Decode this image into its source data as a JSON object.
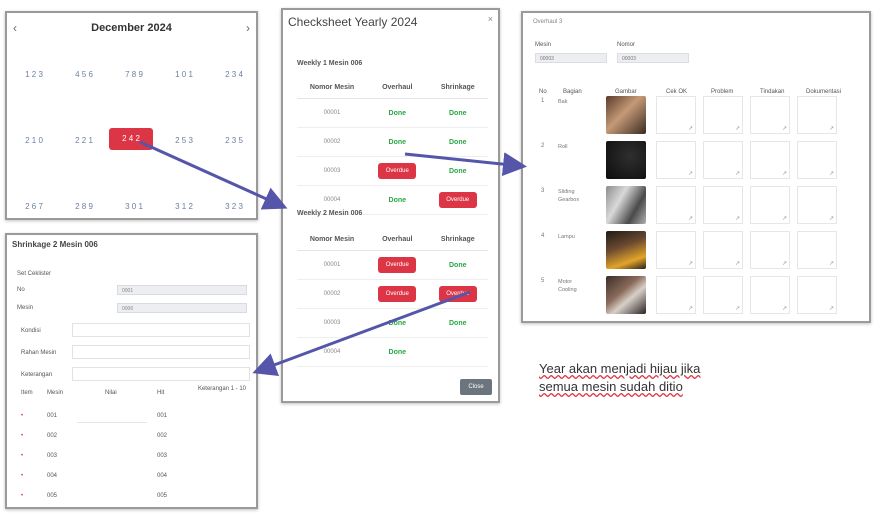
{
  "calendar": {
    "title": "December 2024",
    "prev": "‹",
    "next": "›",
    "days_row1": [
      "1 2 3",
      "4 5 6",
      "7 8 9",
      "1 0 1",
      "2 3 4"
    ],
    "days_row2": [
      "2 1 0",
      "2 2 1",
      "2 5 3",
      "2 3 5"
    ],
    "active_day": "2 4 2",
    "days_row3": [
      "2 6 7",
      "2 8 9",
      "3 0 1",
      "3 1 2",
      "3 2 3"
    ]
  },
  "checksheet": {
    "title": "Checksheet Yearly 2024",
    "close": "×",
    "section1": "Weekly 1 Mesin 006",
    "section2": "Weekly 2 Mesin 006",
    "headers": [
      "Nomor Mesin",
      "Overhaul",
      "Shrinkage"
    ],
    "rows1": [
      {
        "no": "00001",
        "overhaul": "Done",
        "shrinkage": "Done"
      },
      {
        "no": "00002",
        "overhaul": "Done",
        "shrinkage": "Done"
      },
      {
        "no": "00003",
        "overhaul": "Overdue",
        "shrinkage": "Done"
      },
      {
        "no": "00004",
        "overhaul": "Done",
        "shrinkage": "Overdue"
      }
    ],
    "rows2": [
      {
        "no": "00001",
        "overhaul": "Overdue",
        "shrinkage": "Done"
      },
      {
        "no": "00002",
        "overhaul": "Overdue",
        "shrinkage": "Overdue"
      },
      {
        "no": "00003",
        "overhaul": "Done",
        "shrinkage": "Done"
      },
      {
        "no": "00004",
        "overhaul": "Done",
        "shrinkage": ""
      }
    ],
    "close_button": "Close"
  },
  "form": {
    "title": "Shrinkage 2 Mesin 006",
    "sub": "Set Ceklister",
    "f1_label": "No",
    "f1_value": "0001",
    "f2_label": "Mesin",
    "f2_value": "0006",
    "l1": "Kondisi",
    "l2": "Rahan Mesin",
    "l3": "Keterangan",
    "cols": [
      "Item",
      "Mesin",
      "Nilai",
      "Hit",
      "Keterangan 1 - 10"
    ],
    "rows": [
      "001",
      "002",
      "003",
      "004",
      "005"
    ]
  },
  "detail": {
    "title": "Overhaul 3",
    "label1": "Mesin",
    "value1": "00003",
    "label2": "Nomor",
    "value2": "00003",
    "headers": [
      "No",
      "Bagian",
      "Gambar",
      "Cek OK",
      "Problem",
      "Tindakan",
      "Dokumentasi"
    ],
    "rows": [
      {
        "no": "1",
        "part": "Bak"
      },
      {
        "no": "2",
        "part": "Roll"
      },
      {
        "no": "3",
        "part": "Sliding Gearbox"
      },
      {
        "no": "4",
        "part": "Lampu"
      },
      {
        "no": "5",
        "part": "Motor Cooling"
      }
    ]
  },
  "note": {
    "line1": "Year akan menjadi hijau jika",
    "line2": "semua mesin sudah ditio"
  },
  "colors": {
    "red": "#dc3545",
    "green": "#28a745",
    "arrow": "#5555aa"
  }
}
